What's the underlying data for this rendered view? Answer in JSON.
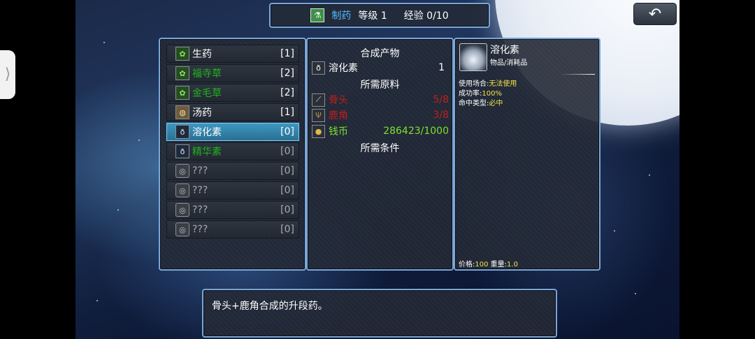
{
  "header": {
    "title": "制药",
    "level": "等级 1",
    "exp": "经验 0/10",
    "title_color": "#55b8ff"
  },
  "back_button": {
    "icon": "undo-arrow-icon"
  },
  "recipe_list": [
    {
      "name": "生药",
      "count": "[1]",
      "icon": "herb-icon",
      "color": "#ffffff"
    },
    {
      "name": "福寺草",
      "count": "[2]",
      "icon": "herb-icon",
      "color": "#1fb21a"
    },
    {
      "name": "金毛草",
      "count": "[2]",
      "icon": "herb-icon",
      "color": "#1fb21a"
    },
    {
      "name": "汤药",
      "count": "[1]",
      "icon": "soup-icon",
      "color": "#ffffff"
    },
    {
      "name": "溶化素",
      "count": "[0]",
      "icon": "potion-bottle-icon",
      "color": "#ffffff",
      "selected": true
    },
    {
      "name": "精华素",
      "count": "[0]",
      "icon": "potion-bottle-icon",
      "color": "#1fb21a"
    },
    {
      "name": "???",
      "count": "[0]",
      "icon": "unknown-recipe-icon",
      "color": "#a8aaae"
    },
    {
      "name": "???",
      "count": "[0]",
      "icon": "unknown-recipe-icon",
      "color": "#a8aaae"
    },
    {
      "name": "???",
      "count": "[0]",
      "icon": "unknown-recipe-icon",
      "color": "#a8aaae"
    },
    {
      "name": "???",
      "count": "[0]",
      "icon": "unknown-recipe-icon",
      "color": "#a8aaae"
    }
  ],
  "synthesis": {
    "product_heading": "合成产物",
    "product": {
      "name": "溶化素",
      "qty": "1",
      "icon": "potion-bottle-icon"
    },
    "materials_heading": "所需原料",
    "materials": [
      {
        "name": "骨头",
        "value": "5/8",
        "icon": "bone-icon",
        "color": "#c01e1e"
      },
      {
        "name": "鹿角",
        "value": "3/8",
        "icon": "antler-icon",
        "color": "#c01e1e"
      },
      {
        "name": "钱币",
        "value": "286423/1000",
        "icon": "coin-icon",
        "color": "#7ee030"
      }
    ],
    "conditions_heading": "所需条件"
  },
  "detail": {
    "name": "溶化素",
    "type": "物品/消耗品",
    "use_label": "使用场合:",
    "use_value": "无法使用",
    "rate_label": "成功率:",
    "rate_value": "100%",
    "hit_label": "命中类型:",
    "hit_value": "必中",
    "price_label": "价格:",
    "price_value": "100",
    "weight_label": "重量:",
    "weight_value": "1.0"
  },
  "description": "骨头+鹿角合成的升段药。"
}
